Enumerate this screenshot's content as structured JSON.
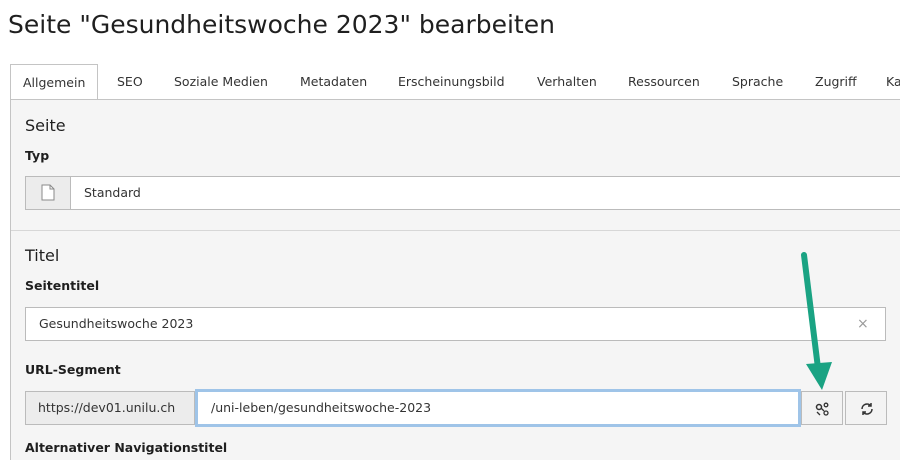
{
  "page": {
    "title": "Seite \"Gesundheitswoche 2023\" bearbeiten"
  },
  "tabs": [
    {
      "label": "Allgemein",
      "active": true
    },
    {
      "label": "SEO"
    },
    {
      "label": "Soziale Medien"
    },
    {
      "label": "Metadaten"
    },
    {
      "label": "Erscheinungsbild"
    },
    {
      "label": "Verhalten"
    },
    {
      "label": "Ressourcen"
    },
    {
      "label": "Sprache"
    },
    {
      "label": "Zugriff"
    },
    {
      "label": "Ka"
    }
  ],
  "seite_section": {
    "heading": "Seite",
    "typ_label": "Typ",
    "typ_value": "Standard",
    "typ_icon": "page-icon"
  },
  "titel_section": {
    "heading": "Titel",
    "seitentitel_label": "Seitentitel",
    "seitentitel_value": "Gesundheitswoche 2023",
    "clear_icon": "×",
    "url_label": "URL-Segment",
    "url_prefix": "https://dev01.unilu.ch",
    "url_value": "/uni-leben/gesundheitswoche-2023",
    "edit_icon": "unlink-icon",
    "refresh_icon": "refresh-icon",
    "next_label": "Alternativer Navigationstitel"
  },
  "annotation": {
    "arrow_color": "#1aa383"
  }
}
